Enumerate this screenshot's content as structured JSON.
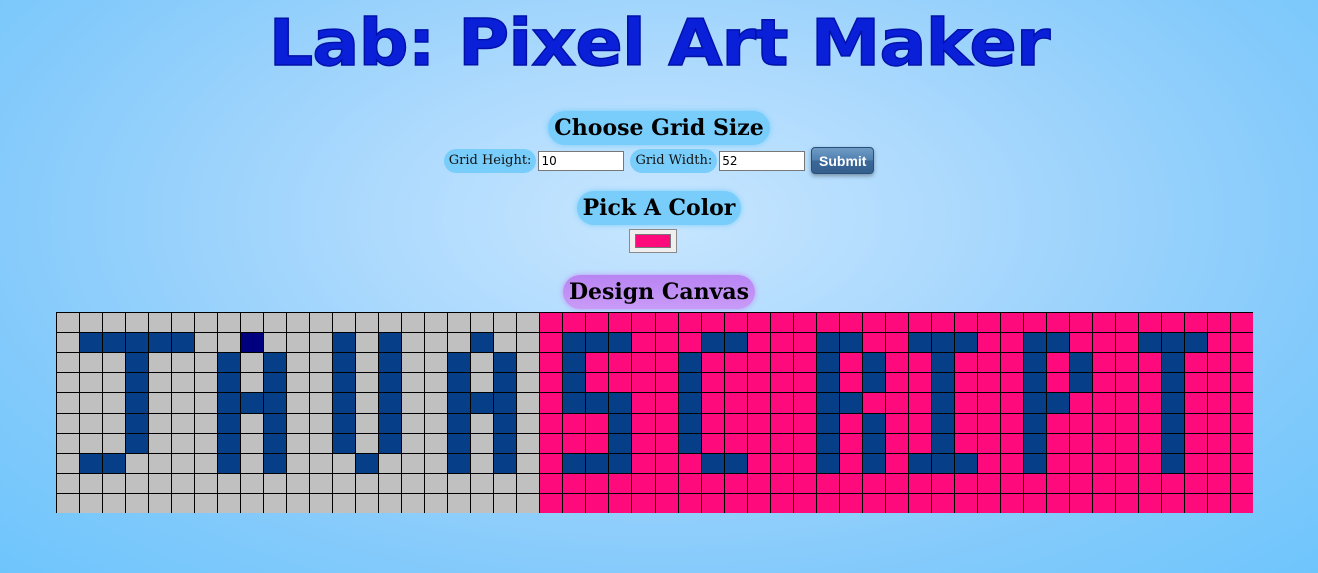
{
  "header": {
    "title": "Lab: Pixel Art Maker"
  },
  "grid_size": {
    "heading": "Choose Grid Size",
    "height_label": "Grid Height:",
    "height_value": "10",
    "width_label": "Grid Width:",
    "width_value": "52",
    "submit_label": "Submit"
  },
  "color_picker": {
    "heading": "Pick A Color",
    "selected_color": "#ff0a7c"
  },
  "canvas": {
    "heading": "Design Canvas",
    "rows": 10,
    "cols": 52,
    "colors": {
      "default": "#c0c0c0",
      "pink": "#ff0a7c",
      "blue": "#063f87",
      "navy": "#00007f"
    },
    "default_color": "default",
    "fills": [
      {
        "color": "pink",
        "rows": [
          0,
          9
        ],
        "cols": [
          21,
          51
        ]
      },
      {
        "color": "blue",
        "rows": [
          1,
          1
        ],
        "cols": [
          1,
          5
        ]
      },
      {
        "color": "navy",
        "rows": [
          1,
          1
        ],
        "cols": [
          8,
          8
        ]
      },
      {
        "color": "blue",
        "rows": [
          2,
          6
        ],
        "cols": [
          3,
          3
        ]
      },
      {
        "color": "blue",
        "rows": [
          7,
          7
        ],
        "cols": [
          1,
          2
        ]
      },
      {
        "color": "blue",
        "rows": [
          2,
          7
        ],
        "cols": [
          7,
          7
        ]
      },
      {
        "color": "blue",
        "rows": [
          2,
          7
        ],
        "cols": [
          9,
          9
        ]
      },
      {
        "color": "blue",
        "rows": [
          4,
          4
        ],
        "cols": [
          8,
          8
        ]
      },
      {
        "color": "blue",
        "rows": [
          1,
          6
        ],
        "cols": [
          12,
          12
        ]
      },
      {
        "color": "blue",
        "rows": [
          1,
          6
        ],
        "cols": [
          14,
          14
        ]
      },
      {
        "color": "blue",
        "rows": [
          7,
          7
        ],
        "cols": [
          13,
          13
        ]
      },
      {
        "color": "blue",
        "rows": [
          1,
          1
        ],
        "cols": [
          18,
          18
        ]
      },
      {
        "color": "blue",
        "rows": [
          2,
          7
        ],
        "cols": [
          17,
          17
        ]
      },
      {
        "color": "blue",
        "rows": [
          2,
          7
        ],
        "cols": [
          19,
          19
        ]
      },
      {
        "color": "blue",
        "rows": [
          4,
          4
        ],
        "cols": [
          18,
          18
        ]
      },
      {
        "color": "blue",
        "rows": [
          1,
          1
        ],
        "cols": [
          22,
          24
        ]
      },
      {
        "color": "blue",
        "rows": [
          2,
          3
        ],
        "cols": [
          22,
          22
        ]
      },
      {
        "color": "blue",
        "rows": [
          4,
          4
        ],
        "cols": [
          22,
          24
        ]
      },
      {
        "color": "blue",
        "rows": [
          5,
          6
        ],
        "cols": [
          24,
          24
        ]
      },
      {
        "color": "blue",
        "rows": [
          7,
          7
        ],
        "cols": [
          22,
          24
        ]
      },
      {
        "color": "blue",
        "rows": [
          1,
          1
        ],
        "cols": [
          28,
          29
        ]
      },
      {
        "color": "blue",
        "rows": [
          2,
          6
        ],
        "cols": [
          27,
          27
        ]
      },
      {
        "color": "blue",
        "rows": [
          7,
          7
        ],
        "cols": [
          28,
          29
        ]
      },
      {
        "color": "blue",
        "rows": [
          1,
          7
        ],
        "cols": [
          33,
          33
        ]
      },
      {
        "color": "blue",
        "rows": [
          1,
          1
        ],
        "cols": [
          34,
          34
        ]
      },
      {
        "color": "blue",
        "rows": [
          2,
          3
        ],
        "cols": [
          35,
          35
        ]
      },
      {
        "color": "blue",
        "rows": [
          4,
          4
        ],
        "cols": [
          34,
          34
        ]
      },
      {
        "color": "blue",
        "rows": [
          5,
          7
        ],
        "cols": [
          35,
          35
        ]
      },
      {
        "color": "blue",
        "rows": [
          1,
          1
        ],
        "cols": [
          37,
          39
        ]
      },
      {
        "color": "blue",
        "rows": [
          2,
          6
        ],
        "cols": [
          38,
          38
        ]
      },
      {
        "color": "blue",
        "rows": [
          7,
          7
        ],
        "cols": [
          37,
          39
        ]
      },
      {
        "color": "blue",
        "rows": [
          1,
          7
        ],
        "cols": [
          42,
          42
        ]
      },
      {
        "color": "blue",
        "rows": [
          1,
          1
        ],
        "cols": [
          43,
          43
        ]
      },
      {
        "color": "blue",
        "rows": [
          2,
          3
        ],
        "cols": [
          44,
          44
        ]
      },
      {
        "color": "blue",
        "rows": [
          4,
          4
        ],
        "cols": [
          43,
          43
        ]
      },
      {
        "color": "blue",
        "rows": [
          1,
          1
        ],
        "cols": [
          47,
          49
        ]
      },
      {
        "color": "blue",
        "rows": [
          2,
          7
        ],
        "cols": [
          48,
          48
        ]
      }
    ]
  }
}
